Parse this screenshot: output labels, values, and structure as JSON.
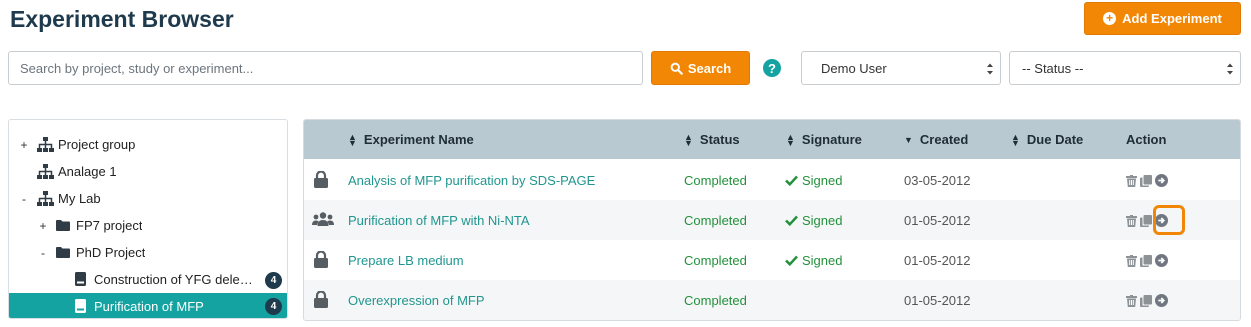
{
  "header": {
    "title": "Experiment Browser",
    "add_button_label": "Add Experiment"
  },
  "search": {
    "placeholder": "Search by project, study or experiment...",
    "value": "",
    "button_label": "Search",
    "help_label": "?"
  },
  "filters": {
    "user": "Demo User",
    "status": "-- Status --"
  },
  "tree": {
    "items": [
      {
        "toggle": "+",
        "icon": "hierarchy-icon",
        "label": "Project group"
      },
      {
        "toggle": "",
        "icon": "hierarchy-icon",
        "label": "Analage 1"
      },
      {
        "toggle": "-",
        "icon": "hierarchy-icon",
        "label": "My Lab"
      },
      {
        "toggle": "+",
        "icon": "folder-icon",
        "label": "FP7 project"
      },
      {
        "toggle": "-",
        "icon": "folder-icon",
        "label": "PhD Project"
      },
      {
        "toggle": "",
        "icon": "notebook-icon",
        "label": "Construction of YFG deletion",
        "badge": "4"
      },
      {
        "toggle": "",
        "icon": "notebook-icon",
        "label": "Purification of MFP",
        "badge": "4",
        "selected": true
      }
    ]
  },
  "table": {
    "headers": {
      "name": "Experiment Name",
      "status": "Status",
      "signature": "Signature",
      "created": "Created",
      "due_date": "Due Date",
      "action": "Action"
    },
    "rows": [
      {
        "icon": "lock-icon",
        "name": "Analysis of MFP purification by SDS-PAGE",
        "status": "Completed",
        "signature": "Signed",
        "created": "03-05-2012",
        "due_date": ""
      },
      {
        "icon": "users-icon",
        "name": "Purification of MFP with Ni-NTA",
        "status": "Completed",
        "signature": "Signed",
        "created": "01-05-2012",
        "due_date": ""
      },
      {
        "icon": "lock-icon",
        "name": "Prepare LB medium",
        "status": "Completed",
        "signature": "Signed",
        "created": "01-05-2012",
        "due_date": ""
      },
      {
        "icon": "lock-icon",
        "name": "Overexpression of MFP",
        "status": "Completed",
        "signature": "",
        "created": "01-05-2012",
        "due_date": ""
      }
    ]
  },
  "colors": {
    "accent_orange": "#f28705",
    "teal": "#14a3a0",
    "navy": "#1e3a4c",
    "header_bg": "#b9c9d1",
    "completed_green": "#23913b"
  }
}
